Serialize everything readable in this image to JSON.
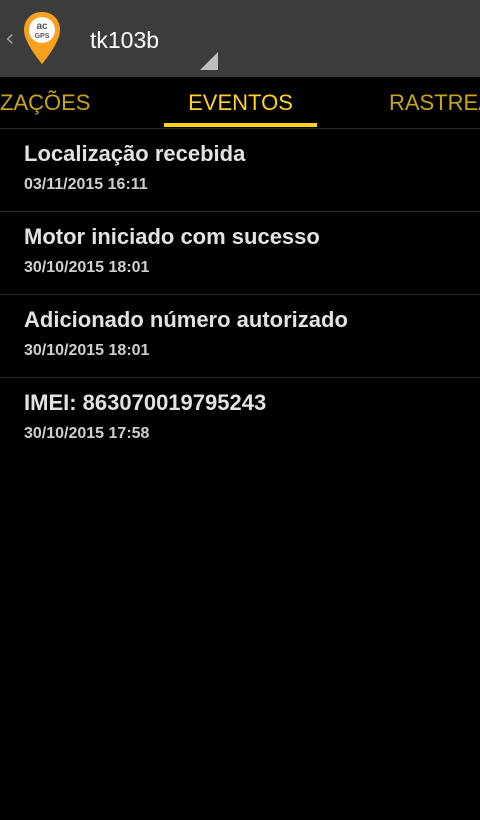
{
  "action_bar": {
    "device_name": "tk103b",
    "logo_text_top": "ac",
    "logo_text_bottom": "GPS",
    "logo_color": "#f6a21e",
    "back_icon": "chevron-left-icon"
  },
  "tabs": {
    "left_label": "ZAÇÕES",
    "active_label": "EVENTOS",
    "right_label": "RASTREA",
    "accent_color": "#ffd21c"
  },
  "events": [
    {
      "title": "Localização recebida",
      "time": "03/11/2015 16:11"
    },
    {
      "title": "Motor iniciado com sucesso",
      "time": "30/10/2015 18:01"
    },
    {
      "title": "Adicionado número autorizado",
      "time": "30/10/2015 18:01"
    },
    {
      "title": "IMEI: 863070019795243",
      "time": "30/10/2015 17:58"
    }
  ]
}
